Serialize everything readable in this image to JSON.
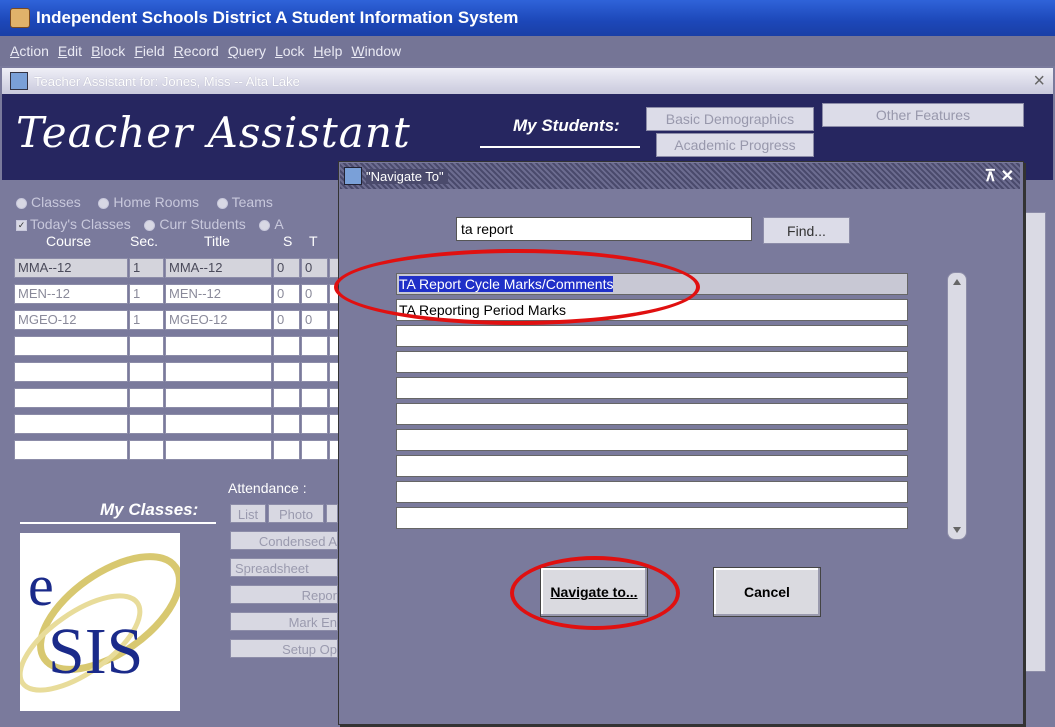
{
  "app": {
    "title": "Independent Schools District A Student Information System"
  },
  "menu": [
    {
      "label": "Action",
      "u": "A"
    },
    {
      "label": "Edit",
      "u": "E"
    },
    {
      "label": "Block",
      "u": "B"
    },
    {
      "label": "Field",
      "u": "F"
    },
    {
      "label": "Record",
      "u": "R"
    },
    {
      "label": "Query",
      "u": "Q"
    },
    {
      "label": "Lock",
      "u": "L"
    },
    {
      "label": "Help",
      "u": "H"
    },
    {
      "label": "Window",
      "u": "W"
    }
  ],
  "inner_window": {
    "title": "Teacher Assistant for: Jones, Miss -- Alta Lake",
    "close": "×"
  },
  "banner": {
    "title": "Teacher Assistant",
    "my_students": "My Students:",
    "buttons": {
      "basic_demographics": "Basic Demographics",
      "academic_progress": "Academic Progress",
      "other_features": "Other Features"
    }
  },
  "left": {
    "radios": {
      "classes": "Classes",
      "home_rooms": "Home Rooms",
      "teams": "Teams"
    },
    "todays_classes": "Today's Classes",
    "curr_students": "Curr Students",
    "partial_a": "A",
    "headers": {
      "course": "Course",
      "sec": "Sec.",
      "title": "Title",
      "s": "S",
      "t": "T"
    },
    "rows": [
      {
        "course": "MMA--12",
        "sec": "1",
        "title": "MMA--12",
        "s": "0",
        "t": "0"
      },
      {
        "course": "MEN--12",
        "sec": "1",
        "title": "MEN--12",
        "s": "0",
        "t": "0"
      },
      {
        "course": "MGEO-12",
        "sec": "1",
        "title": "MGEO-12",
        "s": "0",
        "t": "0"
      }
    ],
    "my_classes": "My Classes:",
    "attendance": "Attendance :",
    "btn_list": "List",
    "btn_photo": "Photo",
    "btn_condensed": "Condensed A",
    "btn_spreadsheet": "Spreadsheet",
    "btn_report": "Repor",
    "btn_mark_entry": "Mark En",
    "btn_setup": "Setup Op",
    "logo_e": "e",
    "logo_sis": "SIS"
  },
  "dialog": {
    "title": "\"Navigate To\"",
    "controls": "⊼ ✕",
    "search_value": "ta report",
    "find_label": "Find...",
    "results": [
      "TA Report Cycle Marks/Comments",
      "TA Reporting Period Marks",
      "",
      "",
      "",
      "",
      "",
      "",
      "",
      ""
    ],
    "navigate_label": "Navigate to...",
    "cancel_label": "Cancel"
  },
  "colors": {
    "annotation": "#e01010",
    "selection": "#2030c8",
    "banner": "#262660",
    "titlebar": "#2f63d9"
  }
}
